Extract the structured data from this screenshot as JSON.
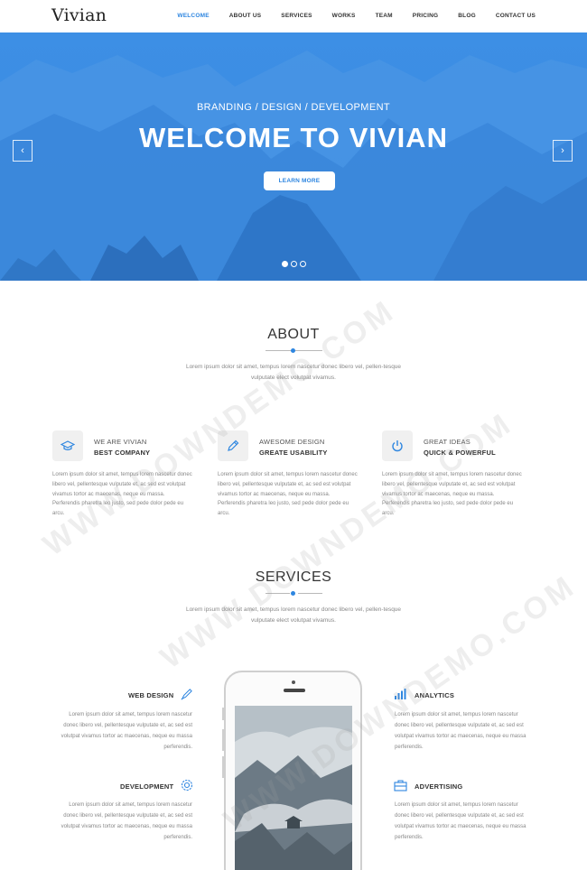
{
  "nav": {
    "logo": "Vivian",
    "items": [
      "WELCOME",
      "ABOUT US",
      "SERVICES",
      "WORKS",
      "TEAM",
      "PRICING",
      "BLOG",
      "CONTACT US"
    ],
    "active_index": 0
  },
  "hero": {
    "subtitle": "BRANDING / DESIGN / DEVELOPMENT",
    "title": "WELCOME TO VIVIAN",
    "button": "LEARN MORE",
    "prev_arrow": "‹",
    "next_arrow": "›",
    "slides": 3,
    "active_slide": 0
  },
  "about": {
    "title": "ABOUT",
    "desc": "Lorem ipsum dolor sit amet, tempus lorem nascetur donec libero vel, pellen-tesque vulputate elect volutpat vivamus.",
    "features": [
      {
        "icon": "graduation-cap-icon",
        "line1": "WE ARE VIVIAN",
        "line2": "BEST COMPANY",
        "text": "Lorem ipsum dolor sit amet, tempus lorem nascetur donec libero vel, pellentesque vulputate et, ac sed est volutpat vivamus tortor ac maecenas, neque eu massa. Perferendis pharetra leo justo, sed pede dolor pede eu arcu."
      },
      {
        "icon": "pencil-icon",
        "line1": "AWESOME DESIGN",
        "line2": "GREATE USABILITY",
        "text": "Lorem ipsum dolor sit amet, tempus lorem nascetur donec libero vel, pellentesque vulputate et, ac sed est volutpat vivamus tortor ac maecenas, neque eu massa. Perferendis pharetra leo justo, sed pede dolor pede eu arcu."
      },
      {
        "icon": "power-icon",
        "line1": "GREAT IDEAS",
        "line2": "QUICK & POWERFUL",
        "text": "Lorem ipsum dolor sit amet, tempus lorem nascetur donec libero vel, pellentesque vulputate et, ac sed est volutpat vivamus tortor ac maecenas, neque eu massa. Perferendis pharetra leo justo, sed pede dolor pede eu arcu."
      }
    ]
  },
  "services": {
    "title": "SERVICES",
    "desc": "Lorem ipsum dolor sit amet, tempus lorem nascetur donec libero vel, pellen-tesque vulputate elect volutpat vivamus.",
    "items": [
      {
        "icon": "brush-icon",
        "title": "WEB DESIGN",
        "text": "Lorem ipsum dolor sit amet, tempus lorem nascetur donec libero vel, pellentesque vulputate et, ac sed est volutpat vivamus tortor ac maecenas, neque eu massa perferendis."
      },
      {
        "icon": "gear-icon",
        "title": "DEVELOPMENT",
        "text": "Lorem ipsum dolor sit amet, tempus lorem nascetur donec libero vel, pellentesque vulputate et, ac sed est volutpat vivamus tortor ac maecenas, neque eu massa perferendis."
      },
      {
        "icon": "bar-chart-icon",
        "title": "ANALYTICS",
        "text": "Lorem ipsum dolor sit amet, tempus lorem nascetur donec libero vel, pellentesque vulputate et, ac sed est volutpat vivamus tortor ac maecenas, neque eu massa perferendis."
      },
      {
        "icon": "briefcase-icon",
        "title": "ADVERTISING",
        "text": "Lorem ipsum dolor sit amet, tempus lorem nascetur donec libero vel, pellentesque vulputate et, ac sed est volutpat vivamus tortor ac maecenas, neque eu massa perferendis."
      }
    ]
  },
  "watermark": "WWW.DOWNDEMO.COM",
  "colors": {
    "accent": "#2e86e0",
    "hero": "#3b8de3",
    "text": "#333333",
    "muted": "#888888"
  }
}
